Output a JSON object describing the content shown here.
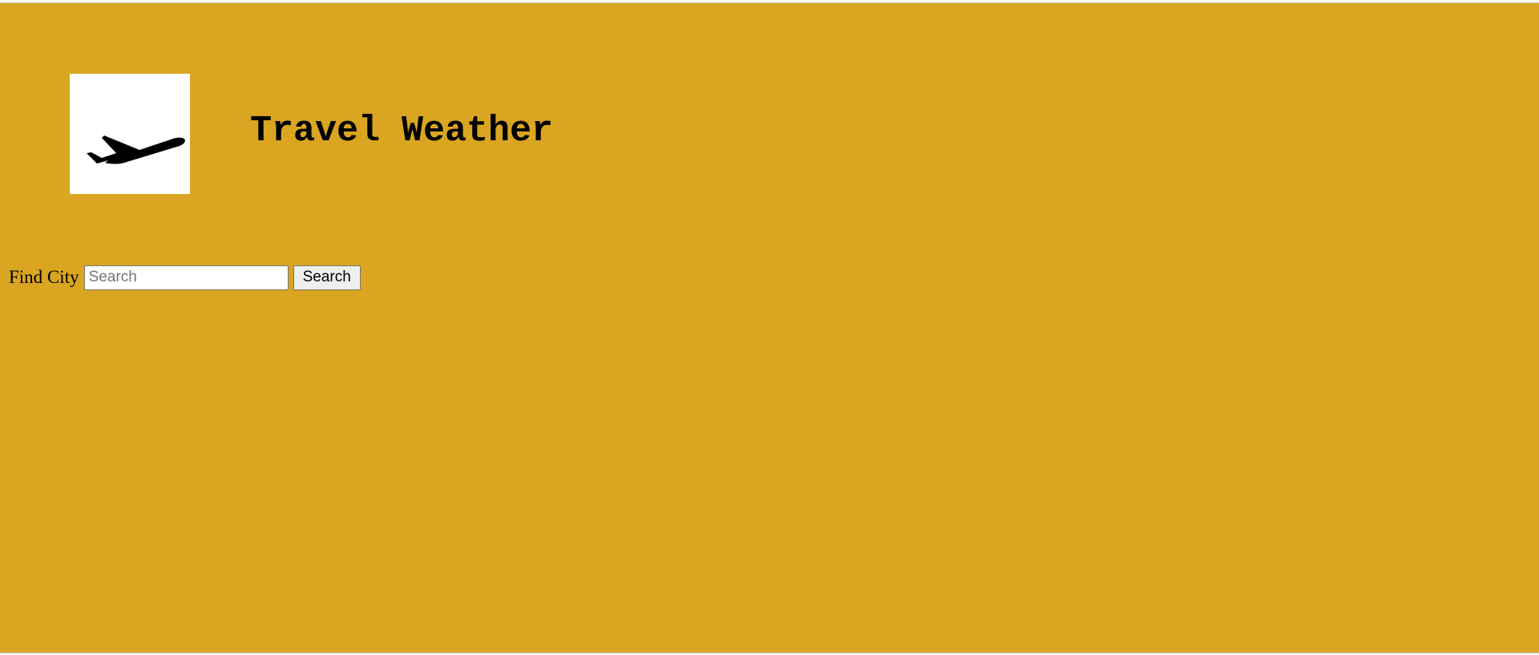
{
  "header": {
    "logo_icon": "airplane-takeoff-icon",
    "title": "Travel Weather"
  },
  "search": {
    "label": "Find City",
    "placeholder": "Search",
    "value": "",
    "button_label": "Search"
  },
  "colors": {
    "background": "#DAA520",
    "logo_background": "#FFFFFF",
    "text": "#000000"
  }
}
